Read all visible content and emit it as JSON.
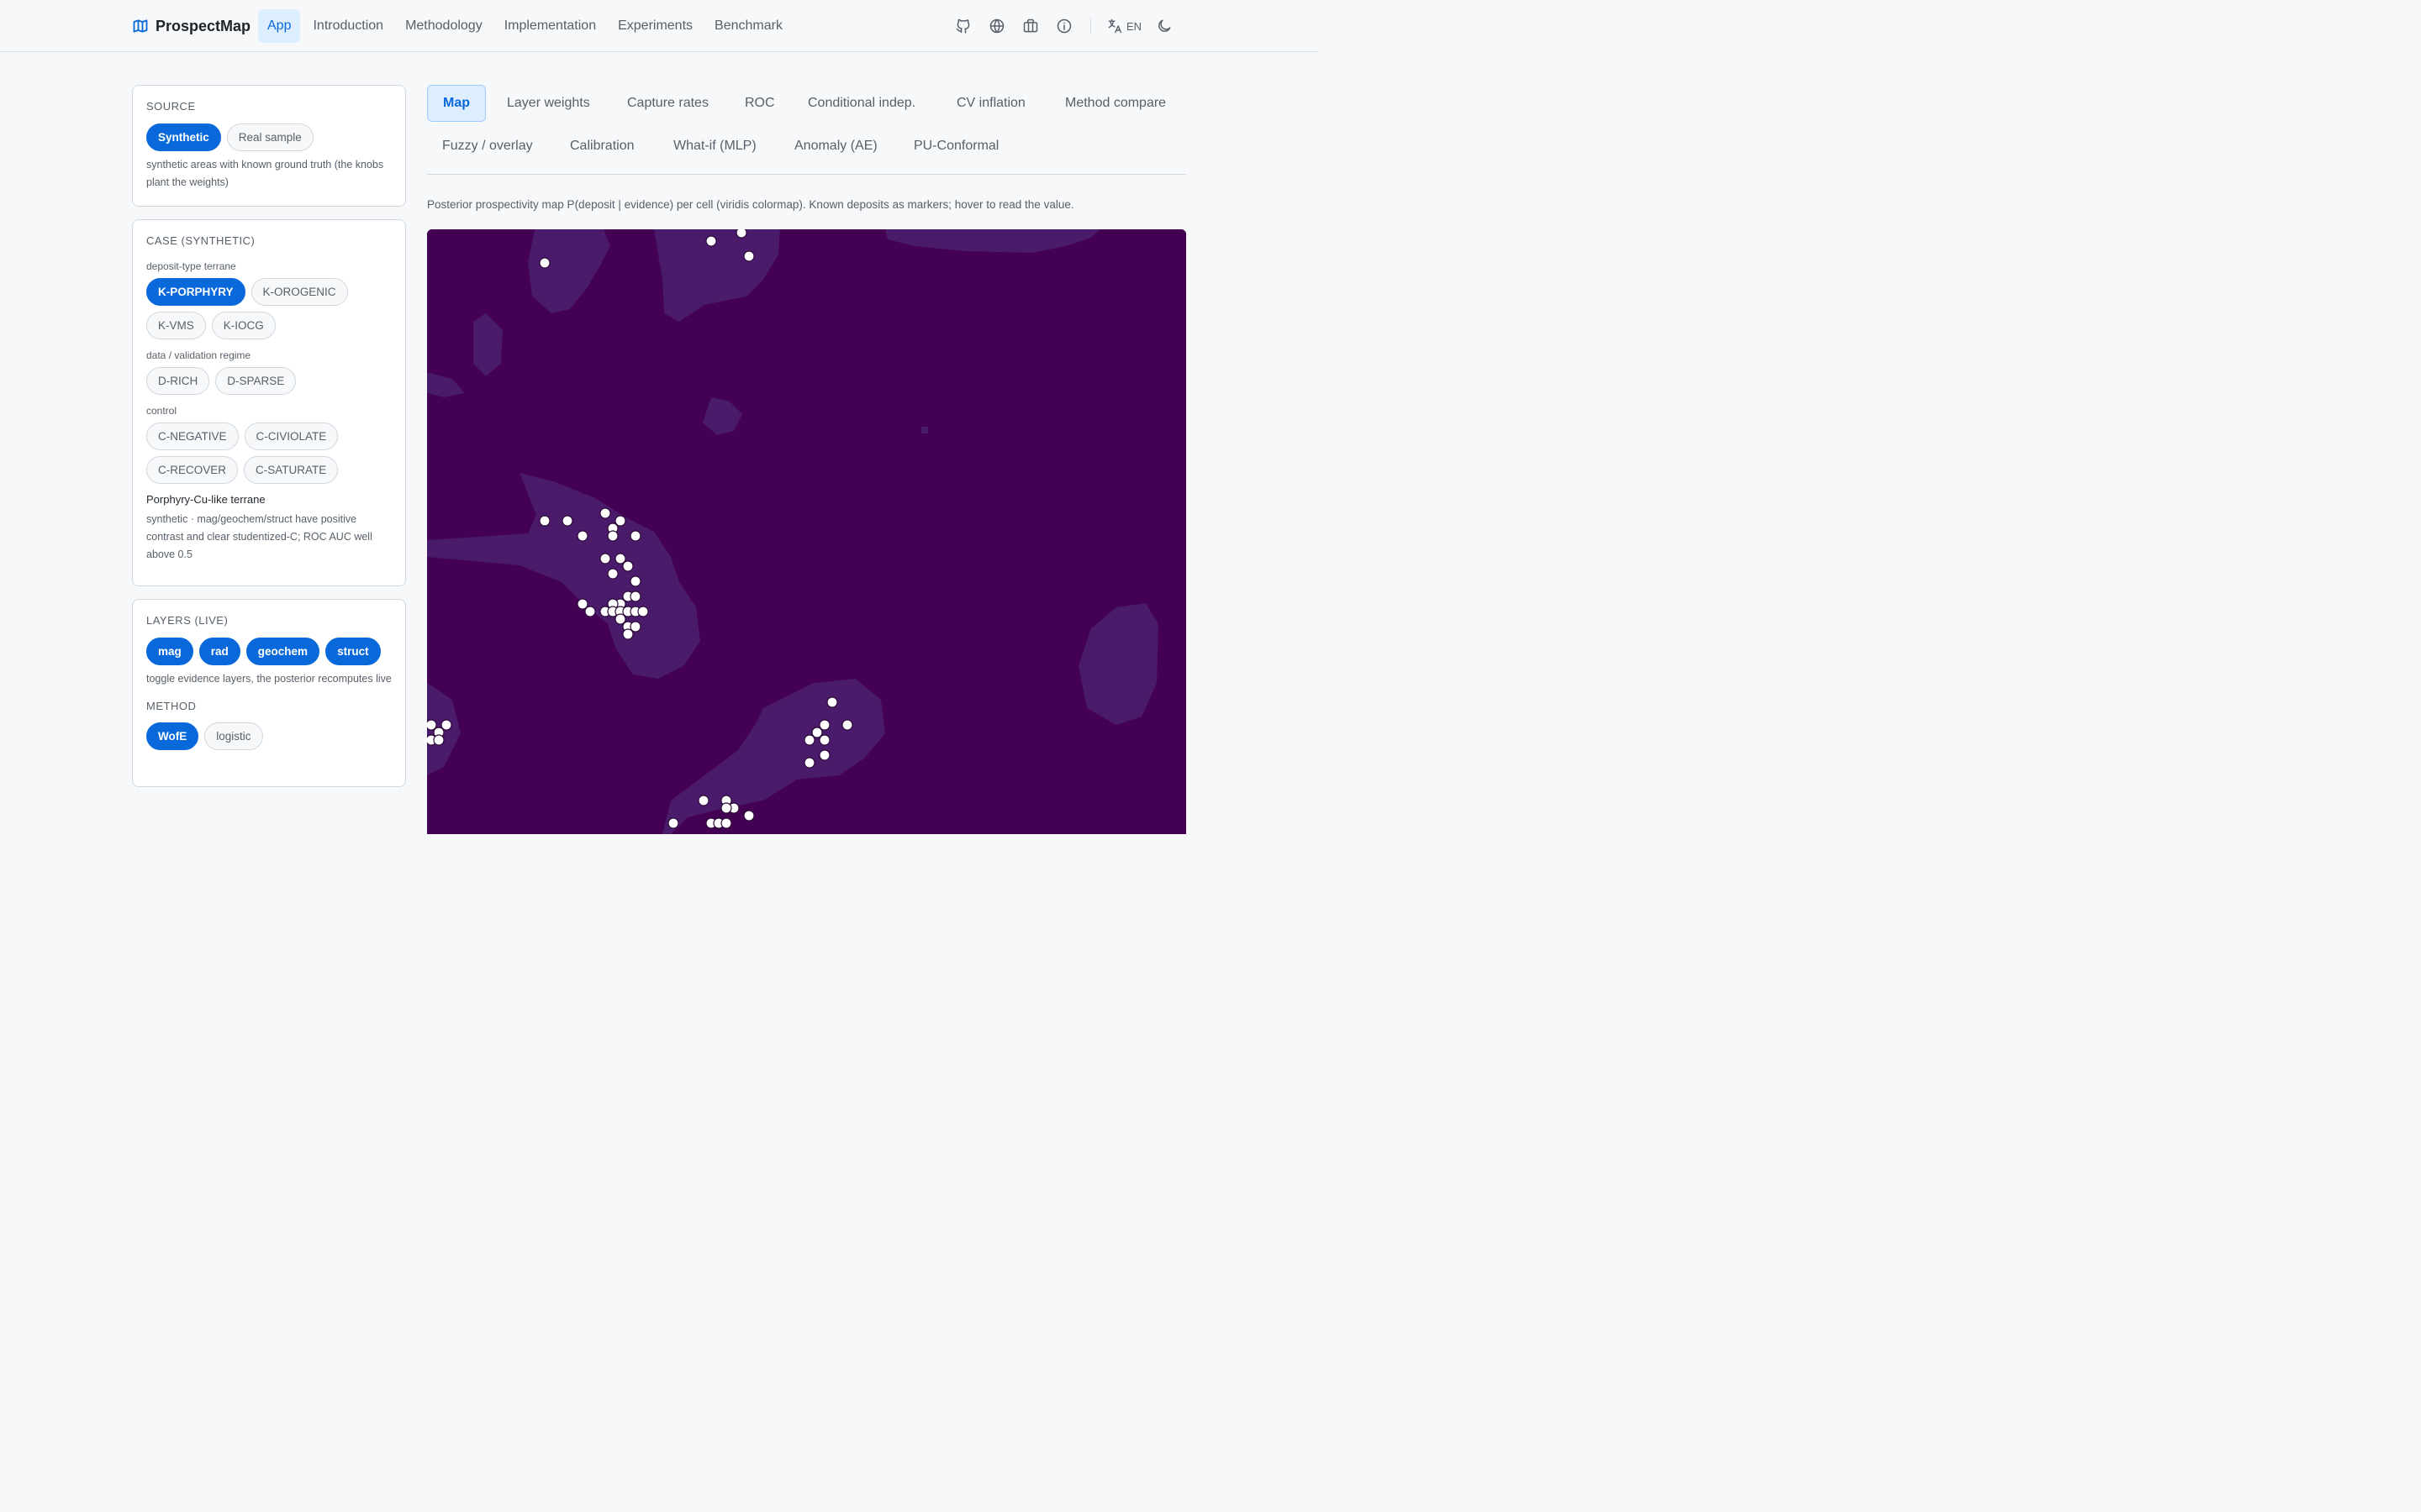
{
  "app": {
    "name": "ProspectMap"
  },
  "nav": {
    "items": [
      "App",
      "Introduction",
      "Methodology",
      "Implementation",
      "Experiments",
      "Benchmark"
    ],
    "active": "App"
  },
  "header_actions": {
    "icons": [
      "github-icon",
      "globe-icon",
      "briefcase-icon",
      "info-icon",
      "translate-icon",
      "moon-icon"
    ],
    "language": "EN"
  },
  "source": {
    "title": "SOURCE",
    "options": [
      "Synthetic",
      "Real sample"
    ],
    "selected": "Synthetic",
    "hint": "synthetic areas with known ground truth (the knobs plant the weights)"
  },
  "case": {
    "title": "CASE (SYNTHETIC)",
    "terrane_label": "deposit-type terrane",
    "terrane_options": [
      "K-PORPHYRY",
      "K-OROGENIC",
      "K-VMS",
      "K-IOCG"
    ],
    "terrane_selected": "K-PORPHYRY",
    "regime_label": "data / validation regime",
    "regime_options": [
      "D-RICH",
      "D-SPARSE"
    ],
    "control_label": "control",
    "control_options": [
      "C-NEGATIVE",
      "C-CIVIOLATE",
      "C-RECOVER",
      "C-SATURATE"
    ],
    "case_name": "Porphyry-Cu-like terrane",
    "case_desc": "synthetic · mag/geochem/struct have positive contrast and clear studentized-C; ROC AUC well above 0.5"
  },
  "layers": {
    "title": "LAYERS (LIVE)",
    "options": [
      "mag",
      "rad",
      "geochem",
      "struct"
    ],
    "active": [
      "mag",
      "rad",
      "geochem",
      "struct"
    ],
    "hint": "toggle evidence layers, the posterior recomputes live",
    "method_title": "METHOD",
    "method_options": [
      "WofE",
      "logistic"
    ],
    "method_selected": "WofE"
  },
  "tabs": {
    "row1": [
      "Map",
      "Layer weights",
      "Capture rates",
      "ROC",
      "Conditional indep.",
      "CV inflation",
      "Method compare"
    ],
    "row2": [
      "Fuzzy / overlay",
      "Calibration",
      "What-if (MLP)",
      "Anomaly (AE)",
      "PU-Conformal"
    ],
    "active": "Map"
  },
  "map": {
    "description": "Posterior prospectivity map P(deposit | evidence) per cell (viridis colormap). Known deposits as markers; hover to read the value.",
    "colors": {
      "background": "#440154",
      "elevated": "#4a1a6b",
      "marker": "#ffffff"
    }
  }
}
